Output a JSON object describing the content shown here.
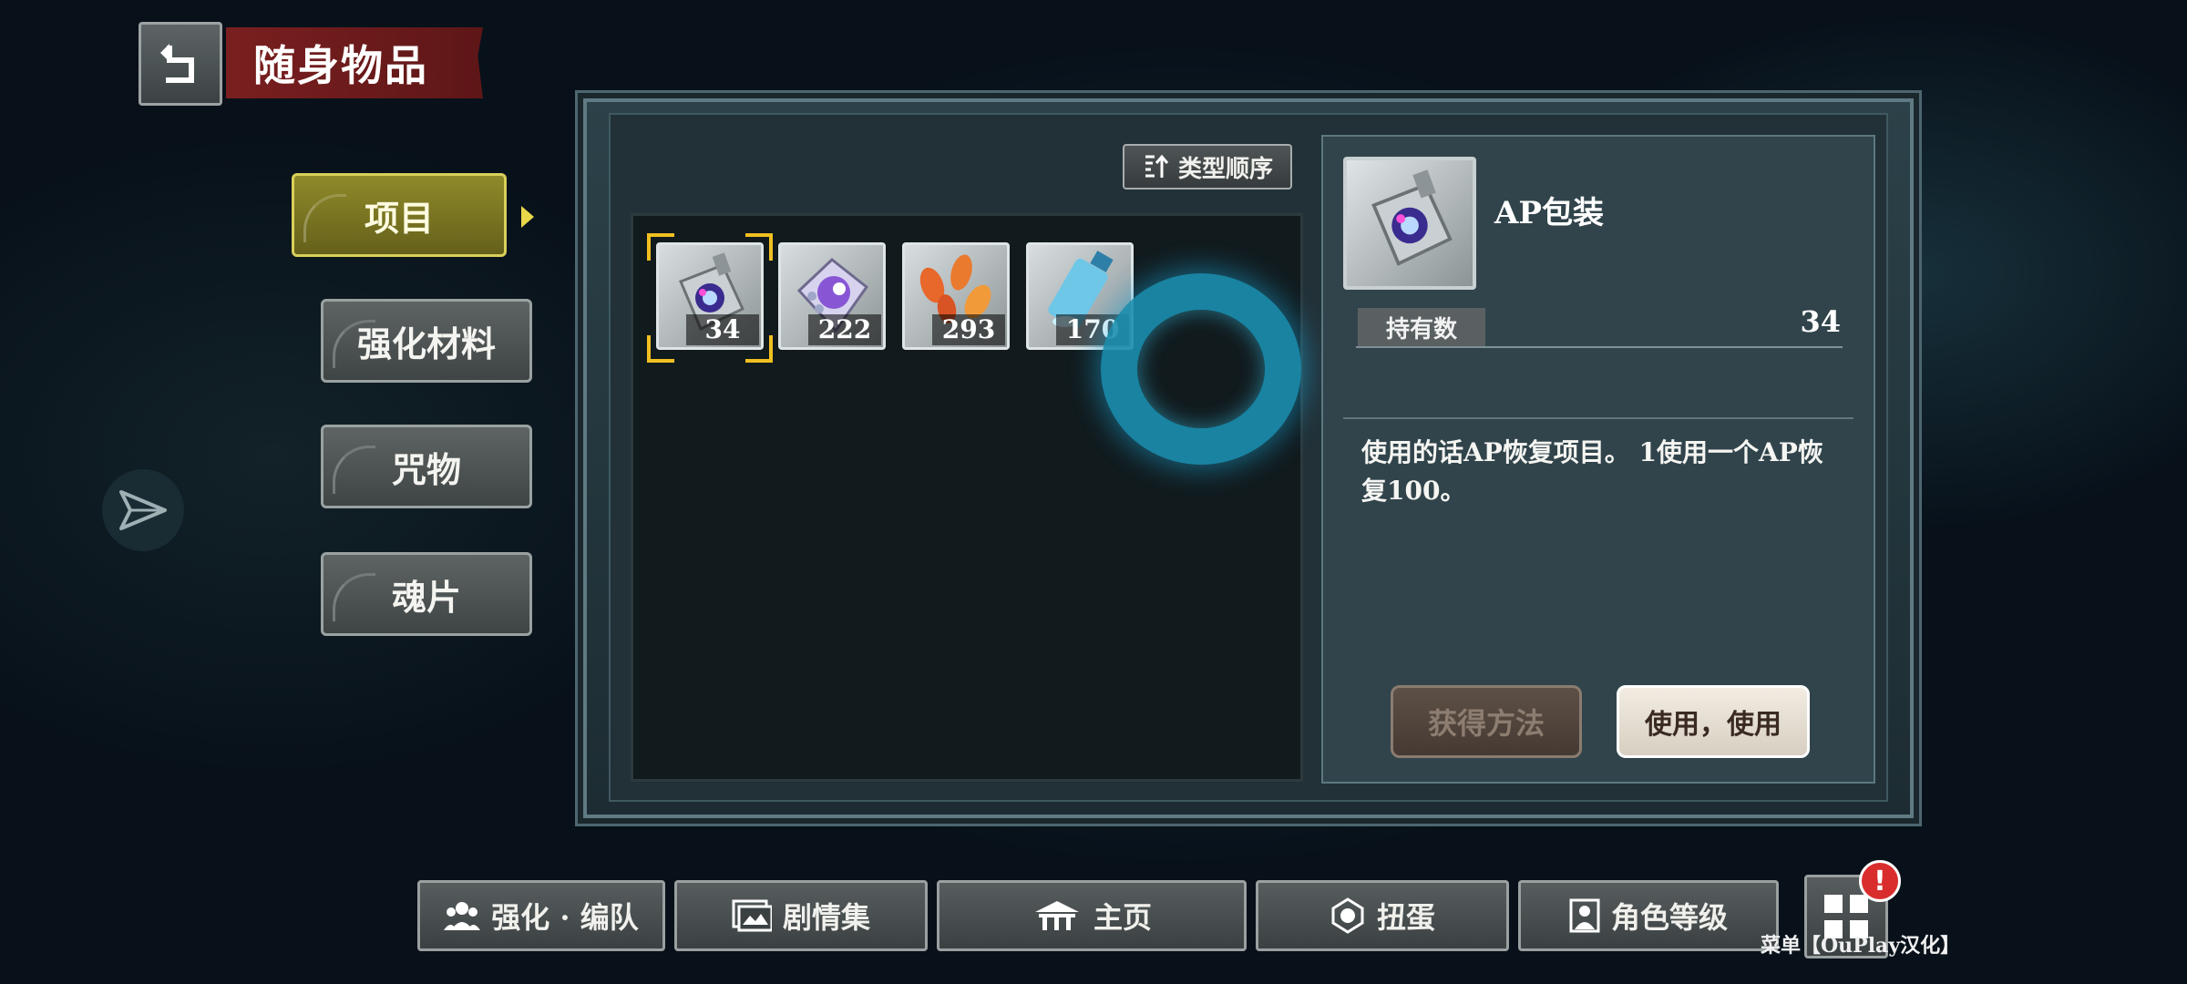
{
  "header": {
    "title": "随身物品",
    "back_icon": "back-arrow-icon"
  },
  "categories": [
    {
      "label": "项目",
      "active": true
    },
    {
      "label": "强化材料",
      "active": false
    },
    {
      "label": "咒物",
      "active": false
    },
    {
      "label": "魂片",
      "active": false
    }
  ],
  "sort": {
    "label": "类型顺序",
    "icon": "sort-icon"
  },
  "items": [
    {
      "name": "AP包装",
      "count": "34",
      "selected": true,
      "icon": "ap-pack-icon"
    },
    {
      "name": "",
      "count": "222",
      "selected": false,
      "icon": "gem-box-icon"
    },
    {
      "name": "",
      "count": "293",
      "selected": false,
      "icon": "petals-icon"
    },
    {
      "name": "",
      "count": "170",
      "selected": false,
      "icon": "blue-bottle-icon"
    }
  ],
  "detail": {
    "name": "AP包装",
    "hold_label": "持有数",
    "hold_value": "34",
    "description": "使用的话AP恢复项目。 1使用一个AP恢复100。",
    "obtain_label": "获得方法",
    "use_label": "使用，使用"
  },
  "nav": [
    {
      "label": "强化 · 编队",
      "icon": "team-icon"
    },
    {
      "label": "剧情集",
      "icon": "story-icon"
    },
    {
      "label": "主页",
      "icon": "home-icon"
    },
    {
      "label": "扭蛋",
      "icon": "gacha-icon"
    },
    {
      "label": "角色等级",
      "icon": "character-icon"
    }
  ],
  "menu": {
    "label": "菜单【OuPlay汉化】",
    "alert": "!"
  },
  "colors": {
    "active_tab": "#8f8a2a",
    "selection": "#f0c020",
    "alert": "#d92d2d",
    "ring": "#1a8fb0"
  }
}
